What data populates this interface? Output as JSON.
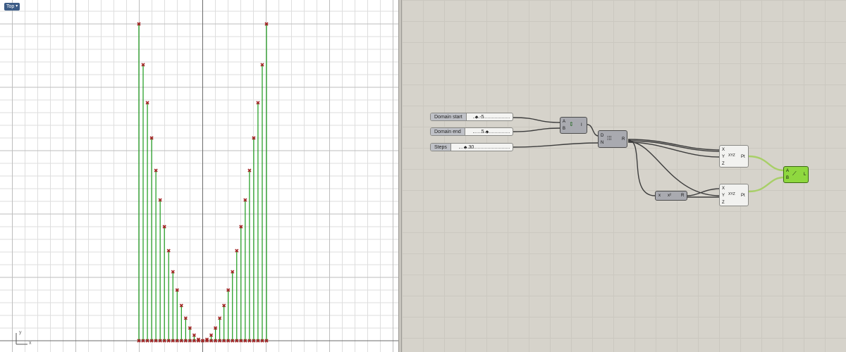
{
  "viewport": {
    "name": "Top",
    "axis_x": "x",
    "axis_y": "y"
  },
  "sliders": {
    "domain_start": {
      "label": "Domain start",
      "value": "-5"
    },
    "domain_end": {
      "label": "Domain end",
      "value": "5"
    },
    "steps": {
      "label": "Steps",
      "value": "30"
    }
  },
  "components": {
    "construct_domain": {
      "inputs": [
        "A",
        "B"
      ],
      "output": "I"
    },
    "range": {
      "inputs": [
        "D",
        "N"
      ],
      "output": "R"
    },
    "construct_point_1": {
      "inputs": [
        "X",
        "Y",
        "Z"
      ],
      "output": "Pt",
      "icon": "XYZ"
    },
    "square": {
      "input": "x",
      "label": "x²",
      "output": "R"
    },
    "construct_point_2": {
      "inputs": [
        "X",
        "Y",
        "Z"
      ],
      "output": "Pt",
      "icon": "XYZ"
    },
    "line": {
      "inputs": [
        "A",
        "B"
      ],
      "output": "L"
    }
  },
  "colors": {
    "stem": "#1a9a1a",
    "point": "#a32424",
    "gh_canvas": "#d6d3cb",
    "line_component": "#8fd83f",
    "wire_highlight": "#a8cf68"
  },
  "chart_data": {
    "type": "scatter",
    "x": [
      -5.0,
      -4.667,
      -4.333,
      -4.0,
      -3.667,
      -3.333,
      -3.0,
      -2.667,
      -2.333,
      -2.0,
      -1.667,
      -1.333,
      -1.0,
      -0.667,
      -0.333,
      0.0,
      0.333,
      0.667,
      1.0,
      1.333,
      1.667,
      2.0,
      2.333,
      2.667,
      3.0,
      3.333,
      3.667,
      4.0,
      4.333,
      4.667,
      5.0
    ],
    "y": [
      25.0,
      21.78,
      18.78,
      16.0,
      13.44,
      11.11,
      9.0,
      7.11,
      5.44,
      4.0,
      2.78,
      1.78,
      1.0,
      0.44,
      0.11,
      0.0,
      0.11,
      0.44,
      1.0,
      1.78,
      2.78,
      4.0,
      5.44,
      7.11,
      9.0,
      11.11,
      13.44,
      16.0,
      18.78,
      21.78,
      25.0
    ],
    "xlim": [
      -5,
      5
    ],
    "ylim": [
      0,
      25
    ],
    "grid": true,
    "title": "",
    "xlabel": "",
    "ylabel": ""
  }
}
